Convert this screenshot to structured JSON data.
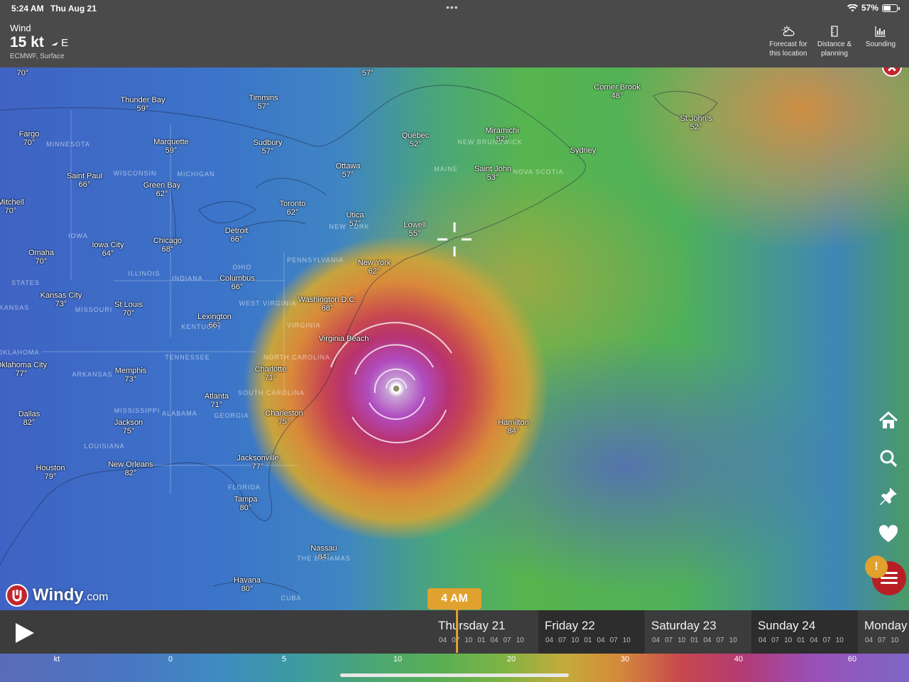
{
  "status_bar": {
    "time": "5:24 AM",
    "date": "Thu Aug 21",
    "dots": "•••",
    "battery": "57%",
    "battery_level": 0.57
  },
  "header": {
    "layer": "Wind",
    "speed": "15 kt",
    "direction": "E",
    "model": "ECMWF, Surface",
    "buttons": [
      {
        "label1": "Forecast for",
        "label2": "this location",
        "icon": "weather-icon"
      },
      {
        "label1": "Distance &",
        "label2": "planning",
        "icon": "ruler-icon"
      },
      {
        "label1": "Sounding",
        "label2": "",
        "icon": "sounding-chart-icon"
      }
    ]
  },
  "map": {
    "cities": [
      {
        "name": "Thunder Bay",
        "temp": "59°"
      },
      {
        "name": "Timmins",
        "temp": "57°"
      },
      {
        "name": "Fargo",
        "temp": "70°"
      },
      {
        "name": "Marquette",
        "temp": "59°"
      },
      {
        "name": "Sudbury",
        "temp": "57°"
      },
      {
        "name": "Québec",
        "temp": "52°"
      },
      {
        "name": "Miramichi",
        "temp": "52°"
      },
      {
        "name": "Corner Brook",
        "temp": "48°"
      },
      {
        "name": "St John's",
        "temp": "52°"
      },
      {
        "name": "Sydney",
        "temp": ""
      },
      {
        "name": "Ottawa",
        "temp": "57°"
      },
      {
        "name": "Saint John",
        "temp": "53°"
      },
      {
        "name": "Saint Paul",
        "temp": "66°"
      },
      {
        "name": "Green Bay",
        "temp": "62°"
      },
      {
        "name": "Toronto",
        "temp": "62°"
      },
      {
        "name": "Mitchell",
        "temp": "70°"
      },
      {
        "name": "Utica",
        "temp": "57°"
      },
      {
        "name": "Lowell",
        "temp": "55°"
      },
      {
        "name": "Detroit",
        "temp": "66°"
      },
      {
        "name": "Chicago",
        "temp": "68°"
      },
      {
        "name": "Iowa City",
        "temp": "64°"
      },
      {
        "name": "Omaha",
        "temp": "70°"
      },
      {
        "name": "New York",
        "temp": "62°"
      },
      {
        "name": "Columbus",
        "temp": "66°"
      },
      {
        "name": "Kansas City",
        "temp": "73°"
      },
      {
        "name": "St Louis",
        "temp": "70°"
      },
      {
        "name": "Washington D.C.",
        "temp": "68°"
      },
      {
        "name": "Lexington",
        "temp": "66°"
      },
      {
        "name": "Virginia Beach",
        "temp": ""
      },
      {
        "name": "Oklahoma City",
        "temp": "77°"
      },
      {
        "name": "Memphis",
        "temp": "73°"
      },
      {
        "name": "Charlotte",
        "temp": "71°"
      },
      {
        "name": "Atlanta",
        "temp": "71°"
      },
      {
        "name": "Charleston",
        "temp": "75°"
      },
      {
        "name": "Hamilton",
        "temp": "84°"
      },
      {
        "name": "Dallas",
        "temp": "82°"
      },
      {
        "name": "Jackson",
        "temp": "75°"
      },
      {
        "name": "Houston",
        "temp": "79°"
      },
      {
        "name": "New Orleans",
        "temp": "82°"
      },
      {
        "name": "Jacksonville",
        "temp": "77°"
      },
      {
        "name": "Tampa",
        "temp": "80°"
      },
      {
        "name": "Nassau",
        "temp": "84°"
      },
      {
        "name": "Havana",
        "temp": "80°"
      }
    ],
    "edge_temps": [
      "70°",
      "57°"
    ],
    "regions": [
      "MINNESOTA",
      "NEW BRUNSWICK",
      "WISCONSIN",
      "MICHIGAN",
      "MAINE",
      "NOVA SCOTIA",
      "IOWA",
      "NEW YORK",
      "PENNSYLVANIA",
      "ILLINOIS",
      "INDIANA",
      "OHIO",
      "STATES",
      "KANSAS",
      "MISSOURI",
      "WEST VIRGINIA",
      "KENTUCKY",
      "VIRGINIA",
      "OKLAHOMA",
      "ARKANSAS",
      "TENNESSEE",
      "NORTH CAROLINA",
      "SOUTH CAROLINA",
      "MISSISSIPPI",
      "ALABAMA",
      "GEORGIA",
      "LOUISIANA",
      "FLORIDA",
      "THE BAHAMAS",
      "CUBA"
    ],
    "logo_main": "Windy",
    "logo_suffix": ".com",
    "alert": "!"
  },
  "timeline": {
    "current_time": "4 AM",
    "days": [
      {
        "label": "Thursday 21",
        "hours": [
          "04",
          "07",
          "10",
          "01",
          "04",
          "07",
          "10"
        ]
      },
      {
        "label": "Friday 22",
        "hours": [
          "04",
          "07",
          "10",
          "01",
          "04",
          "07",
          "10"
        ]
      },
      {
        "label": "Saturday 23",
        "hours": [
          "04",
          "07",
          "10",
          "01",
          "04",
          "07",
          "10"
        ]
      },
      {
        "label": "Sunday 24",
        "hours": [
          "04",
          "07",
          "10",
          "01",
          "04",
          "07",
          "10"
        ]
      },
      {
        "label": "Monday",
        "hours": [
          "04",
          "07",
          "10"
        ]
      }
    ]
  },
  "legend": {
    "unit": "kt",
    "ticks": [
      "0",
      "5",
      "10",
      "20",
      "30",
      "40",
      "60"
    ]
  }
}
